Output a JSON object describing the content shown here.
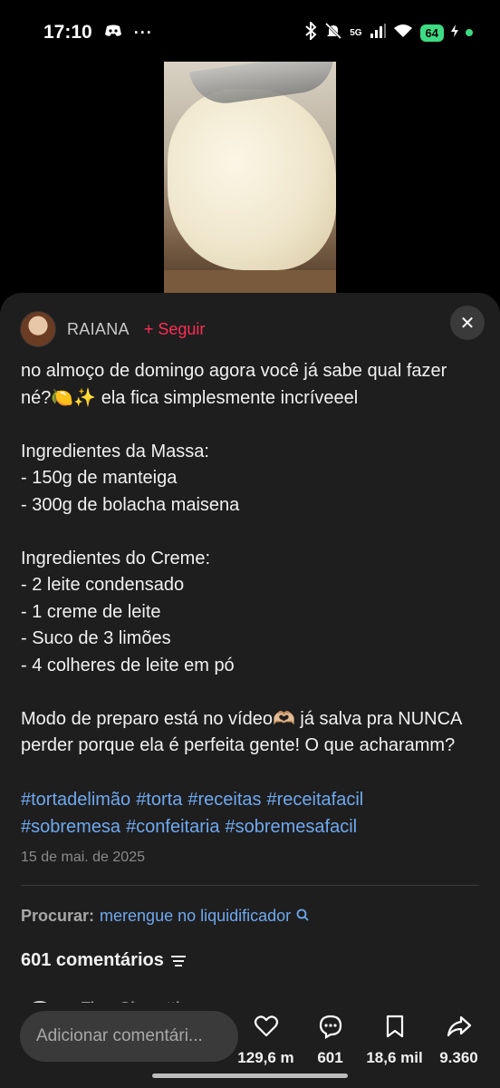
{
  "status_bar": {
    "time": "17:10",
    "signal_label": "5G",
    "battery": "64"
  },
  "video": {
    "description_icon": "video-thumbnail"
  },
  "post": {
    "author": "RAIANA",
    "follow_label": "+ Seguir",
    "caption": "no almoço de domingo agora você já sabe qual fazer né?🍋✨ ela fica simplesmente incríveeel\n\nIngredientes da Massa:\n- 150g de manteiga\n- 300g de bolacha maisena\n\nIngredientes do Creme:\n- 2 leite condensado\n- 1 creme de leite\n- Suco de 3 limões\n- 4 colheres de leite em pó\n\nModo de preparo está no vídeo🫶🏼 já salva pra NUNCA perder porque ela é perfeita gente! O que acharamm?",
    "hashtags": [
      "#tortadelimão",
      "#torta",
      "#receitas",
      "#receitafacil",
      "#sobremesa",
      "#confeitaria",
      "#sobremesafacil"
    ],
    "date": "15 de mai. de 2025"
  },
  "search": {
    "label": "Procurar:",
    "term": "merengue no liquidificador"
  },
  "comments": {
    "count_label": "601 comentários",
    "partial_author": "Thay Giorgetti"
  },
  "bottom_bar": {
    "input_placeholder": "Adicionar comentári...",
    "likes": "129,6 m",
    "comments": "601",
    "saves": "18,6 mil",
    "shares": "9.360"
  },
  "colors": {
    "accent_follow": "#fe2c55",
    "link": "#6fa8ef",
    "sheet_bg": "#1e1e1e",
    "battery": "#3ddc84"
  }
}
